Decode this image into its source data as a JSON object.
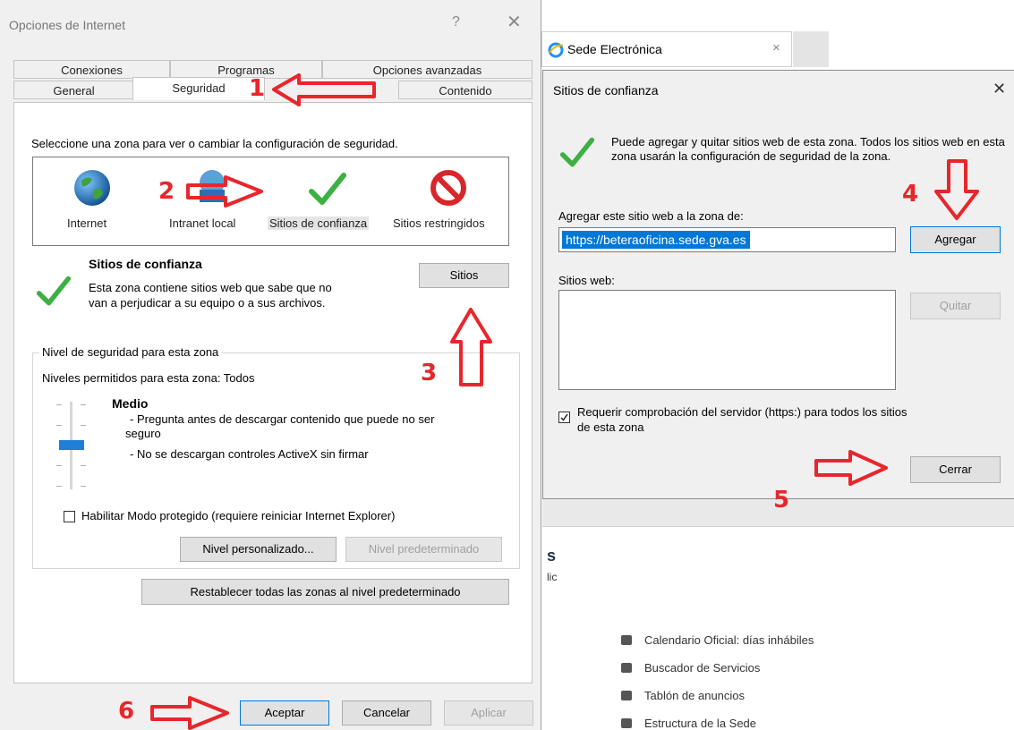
{
  "dialog_options": {
    "title": "Opciones de Internet",
    "help_glyph": "?",
    "close_glyph": "✕",
    "tabs_row1": [
      "Conexiones",
      "Programas",
      "Opciones avanzadas"
    ],
    "tabs_row2": [
      "General",
      "Seguridad",
      "Contenido"
    ],
    "zone_prompt": "Seleccione una zona para ver o cambiar la configuración de seguridad.",
    "zones": [
      "Internet",
      "Intranet local",
      "Sitios de confianza",
      "Sitios restringidos"
    ],
    "zone_title": "Sitios de confianza",
    "zone_description_1": "Esta zona contiene sitios web que sabe que no",
    "zone_description_2": "van a perjudicar a su equipo o a sus archivos.",
    "sites_button": "Sitios",
    "security_group_label": "Nivel de seguridad para esta zona",
    "allowed_levels": "Niveles permitidos para esta zona: Todos",
    "level_name": "Medio",
    "level_desc_1": "- Pregunta antes de descargar contenido que puede no ser",
    "level_desc_1b": "seguro",
    "level_desc_2": "- No se descargan controles ActiveX sin firmar",
    "protected_mode": "Habilitar Modo protegido (requiere reiniciar Internet Explorer)",
    "custom_level_button": "Nivel personalizado...",
    "default_level_button": "Nivel predeterminado",
    "reset_all_button": "Restablecer todas las zonas al nivel predeterminado",
    "ok_button": "Aceptar",
    "cancel_button": "Cancelar",
    "apply_button": "Aplicar"
  },
  "browser": {
    "tab_title": "Sede Electrónica",
    "tab_close": "×",
    "page_fragment_1": "s",
    "page_fragment_2": "lic",
    "menu": [
      "Calendario Oficial: días inhábiles",
      "Buscador de Servicios",
      "Tablón de anuncios",
      "Estructura de la Sede"
    ]
  },
  "dialog_trusted": {
    "title": "Sitios de confianza",
    "close_glyph": "✕",
    "info": "Puede agregar y quitar sitios web de esta zona. Todos los sitios web en esta zona usarán la configuración de seguridad de la zona.",
    "add_label": "Agregar este sitio web a la zona de:",
    "add_value": "https://beteraoficina.sede.gva.es",
    "add_button": "Agregar",
    "sites_label": "Sitios web:",
    "remove_button": "Quitar",
    "require_https": "Requerir comprobación del servidor (https:) para todos los sitios",
    "require_https_2": "de esta zona",
    "close_button": "Cerrar"
  },
  "annotations": [
    "1",
    "2",
    "3",
    "4",
    "5",
    "6"
  ],
  "colors": {
    "annotation_red": "#e8262b",
    "selection_blue": "#0078d7",
    "check_green": "#3cb043",
    "restricted_red": "#d9262b"
  }
}
